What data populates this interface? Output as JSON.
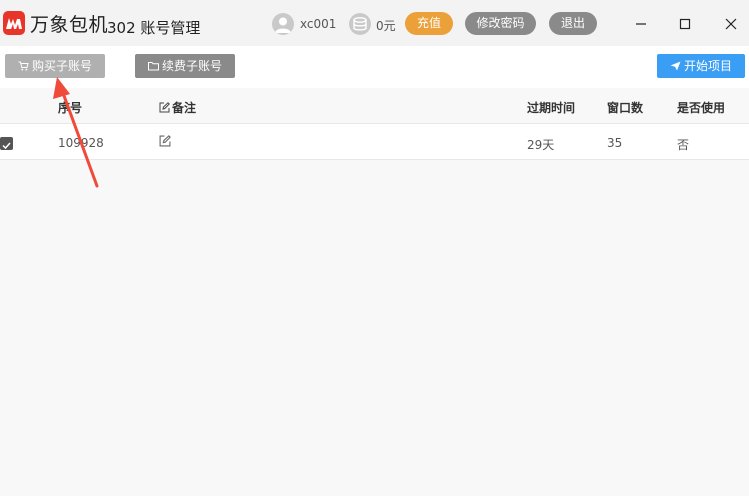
{
  "titlebar": {
    "app_name": "万象包机",
    "page_name": "302 账号管理",
    "user_name": "xc001",
    "balance": "0元",
    "recharge_label": "充值",
    "change_password_label": "修改密码",
    "logout_label": "退出",
    "accent_color": "#e8352a"
  },
  "toolbar": {
    "buy_label": "购买子账号",
    "renew_label": "续费子账号",
    "start_label": "开始项目",
    "start_color": "#3a9ef4"
  },
  "table": {
    "headers": {
      "seq": "序号",
      "remark": "备注",
      "expire": "过期时间",
      "windows": "窗口数",
      "in_use": "是否使用"
    },
    "rows": [
      {
        "checked": true,
        "seq": "109928",
        "remark": "",
        "expire": "29天",
        "windows": "35",
        "in_use": "否"
      }
    ]
  },
  "annotation": {
    "arrow_color": "#f04a3a"
  }
}
